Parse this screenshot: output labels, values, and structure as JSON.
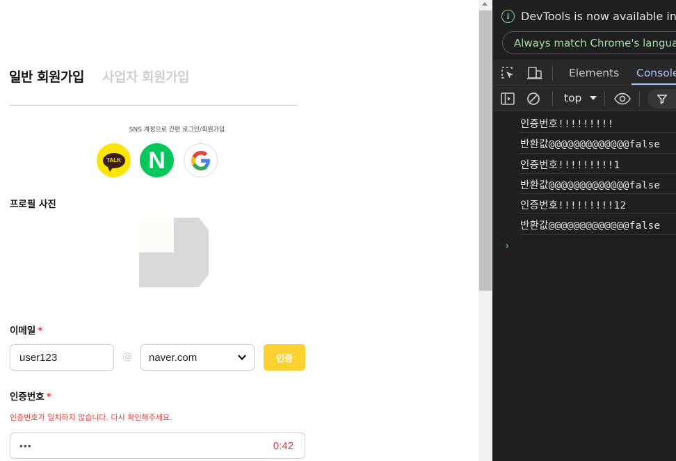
{
  "signup": {
    "tab_personal": "일반 회원가입",
    "tab_business": "사업자 회원가입",
    "sns_caption": "SNS 계정으로 간편 로그인/회원가입",
    "sns": {
      "kakao_label": "TALK",
      "naver_label": "N",
      "google_label": "G"
    },
    "profile_label": "프로필 사진",
    "email_label": "이메일",
    "required_mark": "*",
    "email_id_value": "user123",
    "at_sign": "@",
    "email_domain_value": "naver.com",
    "verify_button": "인증",
    "code_label": "인증번호",
    "code_error": "인증번호가 일치하지 않습니다. 다시 확인해주세요.",
    "code_value": "•••",
    "timer": "0:42"
  },
  "devtools": {
    "info_text": "DevTools is now available in K",
    "match_language_button": "Always match Chrome's languag",
    "tabs": [
      "Elements",
      "Console"
    ],
    "active_tab": "Console",
    "context": "top",
    "console_logs": [
      "인증번호!!!!!!!!!",
      "반환값@@@@@@@@@@@@@false",
      "인증번호!!!!!!!!!1",
      "반환값@@@@@@@@@@@@@false",
      "인증번호!!!!!!!!!12",
      "반환값@@@@@@@@@@@@@false"
    ],
    "prompt": "›"
  },
  "colors": {
    "accent_yellow": "#fdd130",
    "error_red": "#e23b3b",
    "kakao": "#fee500",
    "naver": "#03c75a",
    "devtools_bg": "#1f1f1f",
    "devtools_active_tab": "#a8c7fa",
    "info_green": "#8ad3a0"
  }
}
